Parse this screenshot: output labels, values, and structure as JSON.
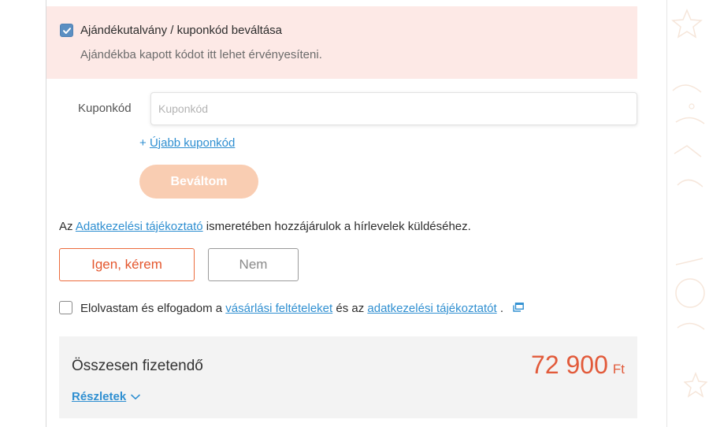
{
  "gift_voucher": {
    "checked": true,
    "title": "Ajándékutalvány / kuponkód beváltása",
    "subtitle": "Ajándékba kapott kódot itt lehet érvényesíteni."
  },
  "coupon": {
    "label": "Kuponkód",
    "placeholder": "Kuponkód",
    "value": "",
    "add_prefix": "+",
    "add_link": "Újabb kuponkód",
    "redeem_button": "Beváltom"
  },
  "newsletter": {
    "text_before": "Az",
    "link": "Adatkezelési tájékoztató",
    "text_after": "ismeretében hozzájárulok a hírlevelek küldéséhez.",
    "yes_button": "Igen, kérem",
    "no_button": "Nem"
  },
  "terms": {
    "checked": false,
    "text_1": "Elolvastam és elfogadom a",
    "link_1": "vásárlási feltételeket",
    "text_2": "és az",
    "link_2": "adatkezelési tájékoztatót",
    "text_3": ".",
    "icon": "external-window-icon"
  },
  "total": {
    "label": "Összesen fizetendő",
    "amount": "72 900",
    "currency": "Ft",
    "details_link": "Részletek",
    "details_icon": "chevron-down-icon"
  },
  "colors": {
    "accent_orange": "#e4572e",
    "link_blue": "#2f8fd1",
    "gift_background": "#fde9e6",
    "redeem_disabled": "#f9cdb2",
    "total_background": "#f3f3f3",
    "checkbox_blue": "#5b8fc2"
  }
}
